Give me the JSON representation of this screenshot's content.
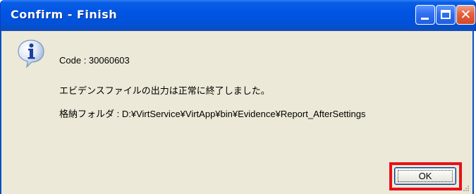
{
  "window": {
    "title": "Confirm - Finish",
    "controls": {
      "minimize_icon": "minimize-icon",
      "maximize_icon": "maximize-icon",
      "close_icon": "close-icon"
    }
  },
  "dialog": {
    "icon": "info-icon",
    "code_line": "Code : 30060603",
    "message": "エビデンスファイルの出力は正常に終了しました。",
    "folder_line": "格納フォルダ : D:¥VirtService¥VirtApp¥bin¥Evidence¥Report_AfterSettings",
    "ok_label": "OK"
  },
  "colors": {
    "titlebar": "#0054e3",
    "client_bg": "#ece9d8",
    "highlight": "#e8101a"
  }
}
